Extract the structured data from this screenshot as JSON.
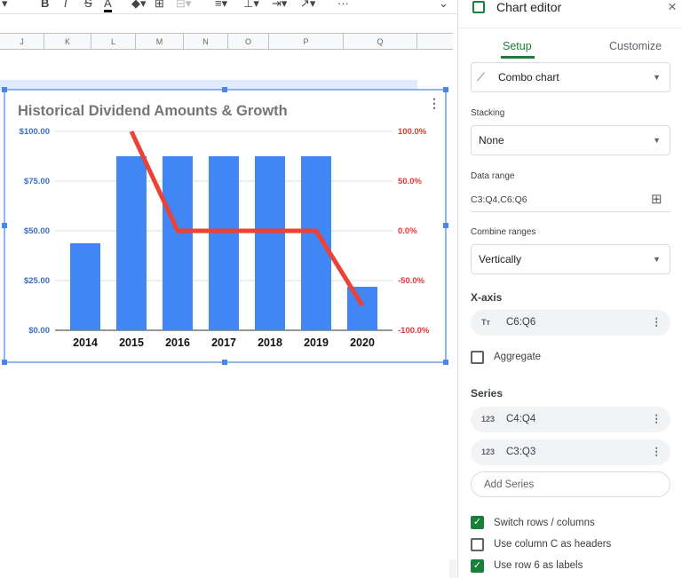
{
  "toolbar": {
    "bold": "B",
    "italic": "I",
    "strike": "S",
    "textcolor": "A",
    "more": "···"
  },
  "columns": [
    "J",
    "K",
    "L",
    "M",
    "N",
    "O",
    "P",
    "Q"
  ],
  "chart_data": {
    "type": "combo",
    "title": "Historical Dividend Amounts & Growth",
    "categories": [
      "2014",
      "2015",
      "2016",
      "2017",
      "2018",
      "2019",
      "2020"
    ],
    "series": [
      {
        "name": "C4:Q4",
        "type": "bar",
        "axis": "left",
        "color": "#4285f4",
        "values": [
          43.75,
          87.5,
          87.5,
          87.5,
          87.5,
          87.5,
          21.875
        ]
      },
      {
        "name": "C3:Q3",
        "type": "line",
        "axis": "right",
        "color": "#ea4335",
        "values": [
          null,
          100,
          0,
          0,
          0,
          0,
          -75
        ]
      }
    ],
    "left_axis": {
      "ticks": [
        "$0.00",
        "$25.00",
        "$50.00",
        "$75.00",
        "$100.00"
      ],
      "range": [
        0,
        100
      ]
    },
    "right_axis": {
      "ticks": [
        "-100.0%",
        "-50.0%",
        "0.0%",
        "50.0%",
        "100.0%"
      ],
      "range": [
        -100,
        100
      ]
    }
  },
  "panel": {
    "title": "Chart editor",
    "close": "×",
    "tabs": [
      {
        "label": "Setup",
        "active": true
      },
      {
        "label": "Customize",
        "active": false
      }
    ],
    "chart_type": "Combo chart",
    "stacking_label": "Stacking",
    "stacking": "None",
    "range_label": "Data range",
    "range": "C3:Q4,C6:Q6",
    "combine_label": "Combine ranges",
    "combine": "Vertically",
    "xaxis_label": "X-axis",
    "xaxis": {
      "icon": "Tт",
      "range": "C6:Q6"
    },
    "aggregate": "Aggregate",
    "series_label": "Series",
    "series": [
      {
        "icon": "123",
        "range": "C4:Q4"
      },
      {
        "icon": "123",
        "range": "C3:Q3"
      }
    ],
    "add_series": "Add Series",
    "options": [
      {
        "label": "Switch rows / columns",
        "checked": true
      },
      {
        "label": "Use column C as headers",
        "checked": false
      },
      {
        "label": "Use row 6 as labels",
        "checked": true
      }
    ]
  }
}
